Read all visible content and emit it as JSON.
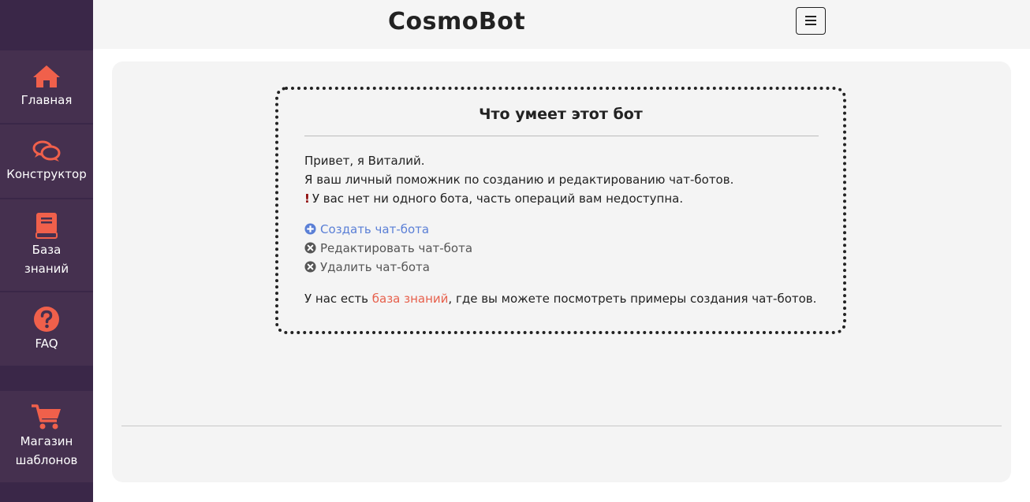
{
  "colors": {
    "sidebar_bg": "#3a2748",
    "nav_item_bg": "#45304f",
    "accent_icon": "#f0604b",
    "link_blue": "#5a7fd6",
    "link_orange": "#e7604c"
  },
  "sidebar": {
    "items": [
      {
        "label": "Главная",
        "icon": "home-icon"
      },
      {
        "label": "Конструктор",
        "icon": "chat-bubbles-icon"
      },
      {
        "label": "База\nзнаний",
        "icon": "book-icon"
      },
      {
        "label": "FAQ",
        "icon": "question-circle-icon"
      },
      {
        "label": "Магазин\nшаблонов",
        "icon": "shopping-cart-icon"
      }
    ]
  },
  "header": {
    "title": "CosmoBot",
    "menu_icon": "hamburger-icon"
  },
  "card": {
    "title": "Что умеет этот бот",
    "greeting": "Привет, я Виталий.",
    "intro": "Я ваш личный поможник по созданию и редактированию чат-ботов.",
    "warning_mark": "!",
    "warning": "У вас нет ни одного бота, часть операций вам недоступна.",
    "actions": [
      {
        "label": "Создать чат-бота",
        "icon": "plus-circle-icon"
      },
      {
        "label": "Редактировать чат-бота",
        "icon": "x-circle-icon"
      },
      {
        "label": "Удалить чат-бота",
        "icon": "x-circle-icon"
      }
    ],
    "footer_prefix": "У нас есть ",
    "footer_link": "база знаний",
    "footer_suffix": ", где вы можете посмотреть примеры создания чат-ботов."
  }
}
